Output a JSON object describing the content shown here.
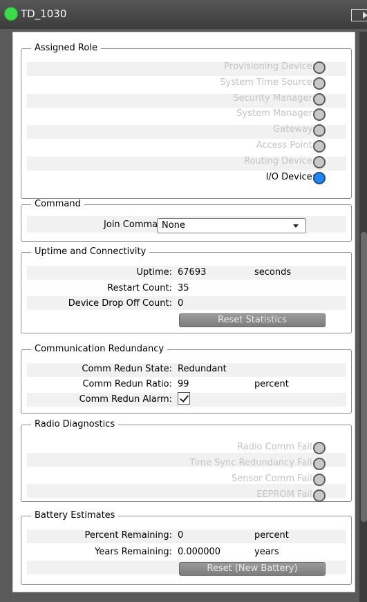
{
  "title": "TD_1030",
  "assigned_role": {
    "legend": "Assigned Role",
    "roles": [
      {
        "label": "Provisioning Device:",
        "active": false
      },
      {
        "label": "System Time Source:",
        "active": false
      },
      {
        "label": "Security Manager:",
        "active": false
      },
      {
        "label": "System Manager:",
        "active": false
      },
      {
        "label": "Gateway:",
        "active": false
      },
      {
        "label": "Access Point:",
        "active": false
      },
      {
        "label": "Routing Device:",
        "active": false
      },
      {
        "label": "I/O Device:",
        "active": true
      }
    ]
  },
  "command": {
    "legend": "Command",
    "join_label": "Join Command:",
    "join_value": "None"
  },
  "uptime": {
    "legend": "Uptime and Connectivity",
    "uptime_label": "Uptime:",
    "uptime_value": "67693",
    "uptime_unit": "seconds",
    "restart_label": "Restart Count:",
    "restart_value": "35",
    "drop_label": "Device Drop Off Count:",
    "drop_value": "0",
    "reset_button": "Reset Statistics"
  },
  "redundancy": {
    "legend": "Communication Redundancy",
    "state_label": "Comm Redun State:",
    "state_value": "Redundant",
    "ratio_label": "Comm Redun Ratio:",
    "ratio_value": "99",
    "ratio_unit": "percent",
    "alarm_label": "Comm Redun Alarm:",
    "alarm_checked": true
  },
  "radio": {
    "legend": "Radio Diagnostics",
    "items": [
      {
        "label": "Radio Comm Fail:"
      },
      {
        "label": "Time Sync Redundancy Fail:"
      },
      {
        "label": "Sensor Comm Fail:"
      },
      {
        "label": "EEPROM Fail:"
      }
    ]
  },
  "battery": {
    "legend": "Battery Estimates",
    "percent_label": "Percent Remaining:",
    "percent_value": "0",
    "percent_unit": "percent",
    "years_label": "Years Remaining:",
    "years_value": "0.000000",
    "years_unit": "years",
    "reset_button": "Reset (New Battery)"
  },
  "colors": {
    "status_green": "#3ddc4a",
    "active_blue": "#1e88f0",
    "inactive_gray": "#c8c8c8"
  }
}
